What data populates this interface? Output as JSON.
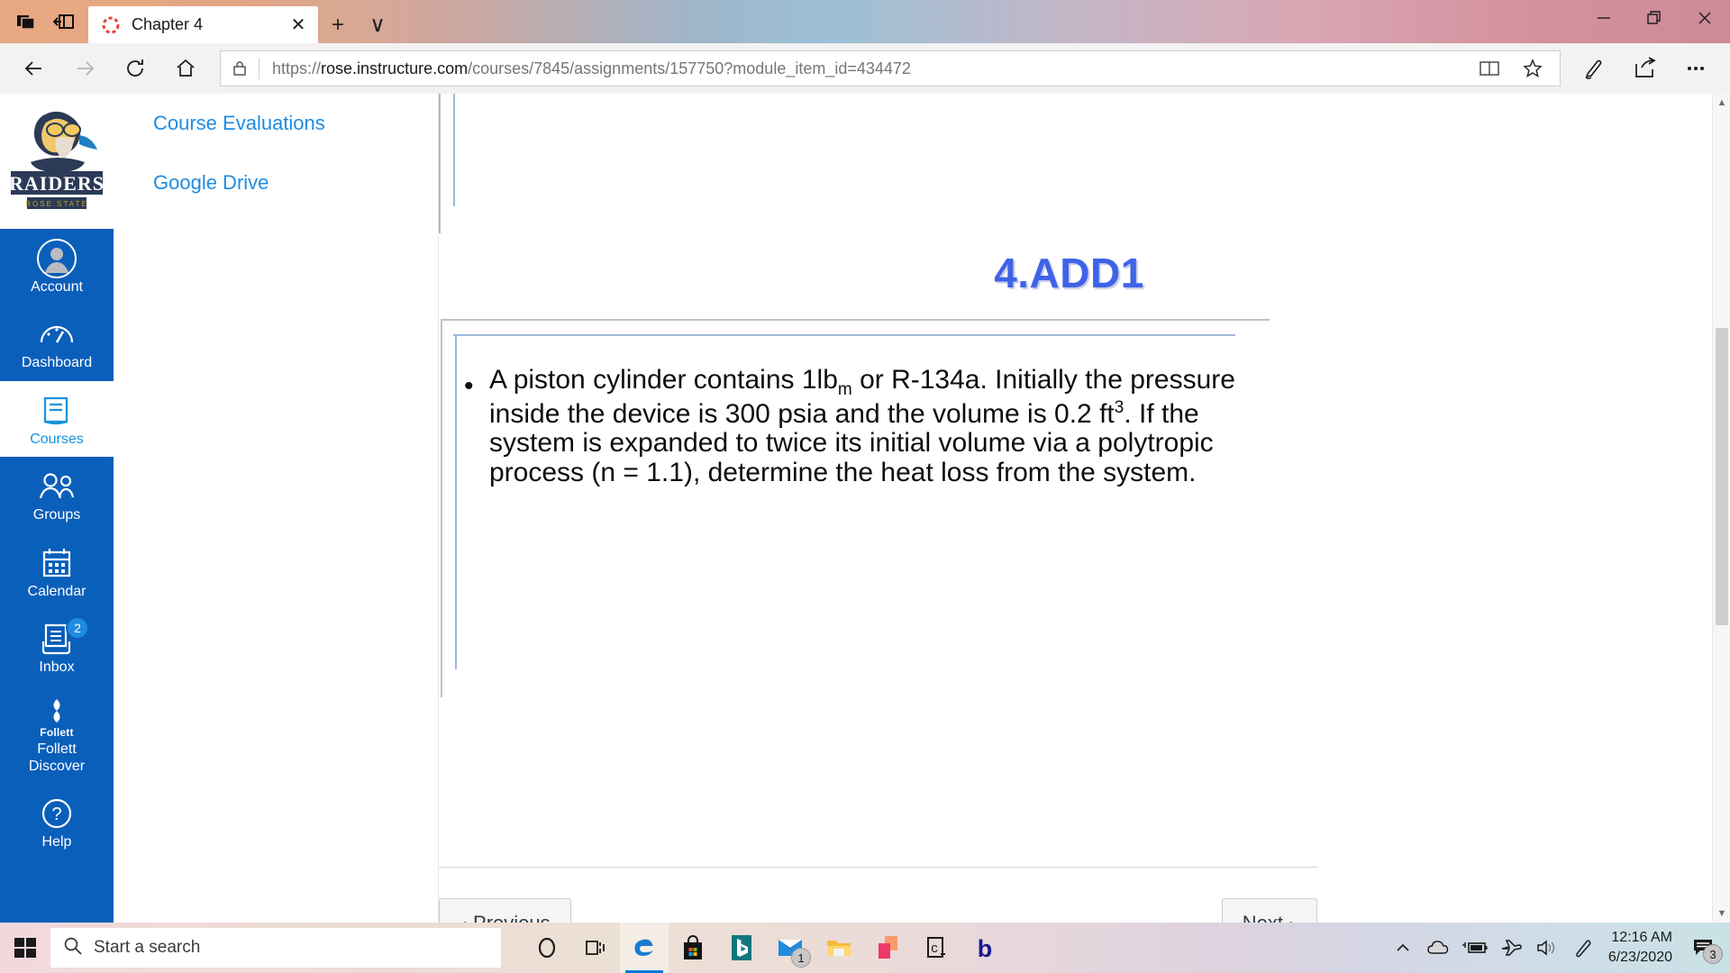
{
  "browser": {
    "tab": {
      "title": "Chapter 4",
      "favicon": "loading-spinner-icon",
      "close_label": "✕"
    },
    "new_tab_label": "+",
    "tab_menu_label": "∨",
    "window_controls": {
      "minimize": "—",
      "restore": "❐",
      "close": "✕"
    },
    "nav": {
      "back": "←",
      "forward": "→",
      "refresh": "↻",
      "home": "⌂"
    },
    "address": {
      "scheme": "https://",
      "host": "rose.instructure.com",
      "path": "/courses/7845/assignments/157750?module_item_id=434472",
      "full_url": "https://rose.instructure.com/courses/7845/assignments/157750?module_item_id=434472",
      "lock_icon": "lock-icon",
      "reading_view_icon": "book-icon",
      "favorite_icon": "star-icon"
    },
    "toolbar": {
      "notes_icon": "pen-icon",
      "share_icon": "share-icon",
      "more_icon": "ellipsis-icon"
    }
  },
  "sidebar": {
    "logo_alt": "RAIDERS ROSE STATE",
    "items": [
      {
        "label": "Account",
        "icon": "user-avatar-icon",
        "active": false,
        "badge": null
      },
      {
        "label": "Dashboard",
        "icon": "dashboard-gauge-icon",
        "active": false,
        "badge": null
      },
      {
        "label": "Courses",
        "icon": "book-icon",
        "active": true,
        "badge": null
      },
      {
        "label": "Groups",
        "icon": "people-icon",
        "active": false,
        "badge": null
      },
      {
        "label": "Calendar",
        "icon": "calendar-icon",
        "active": false,
        "badge": null
      },
      {
        "label": "Inbox",
        "icon": "inbox-tray-icon",
        "active": false,
        "badge": "2"
      },
      {
        "label": "Follett\nDiscover",
        "icon": "follett-diamond-icon",
        "brand": "Follett",
        "active": false,
        "badge": null
      },
      {
        "label": "Help",
        "icon": "question-circle-icon",
        "active": false,
        "badge": null
      }
    ]
  },
  "course_nav": {
    "links": [
      {
        "label": "Course Evaluations"
      },
      {
        "label": "Google Drive"
      }
    ]
  },
  "slide": {
    "title": "4.ADD1",
    "bullet_marker": "•",
    "body_parts": [
      {
        "t": "A piston cylinder contains 1lb"
      },
      {
        "t": "m",
        "s": "sub"
      },
      {
        "t": " or R-134a. Initially the pressure inside the device is 300 psia and the volume is 0.2 ft"
      },
      {
        "t": "3",
        "s": "sup"
      },
      {
        "t": ". If the system is expanded to twice its initial volume via a polytropic process (n = 1.1), determine the heat loss from the system."
      }
    ],
    "body_text": "A piston cylinder contains 1lbm or R-134a. Initially the pressure inside the device is 300 psia and the volume is 0.2 ft3. If the system is expanded to twice its initial volume via a polytropic process (n = 1.1), determine the heat loss from the system."
  },
  "pager": {
    "previous_label": "Previous",
    "next_label": "Next",
    "prev_caret": "◂",
    "next_caret": "▸"
  },
  "scrollbar": {
    "up": "▲",
    "down": "▼"
  },
  "taskbar": {
    "start_label": "start-button",
    "search_placeholder": "Start a search",
    "search_icon": "magnifier-icon",
    "items": [
      {
        "name": "cortana-icon",
        "label": "Cortana",
        "active": false,
        "badge": null
      },
      {
        "name": "task-view-icon",
        "label": "Task View",
        "active": false,
        "badge": null
      },
      {
        "name": "edge-icon",
        "label": "Microsoft Edge",
        "active": true,
        "badge": null
      },
      {
        "name": "microsoft-store-icon",
        "label": "Microsoft Store",
        "active": false,
        "badge": null
      },
      {
        "name": "bing-icon",
        "label": "Bing",
        "active": false,
        "badge": null
      },
      {
        "name": "mail-icon",
        "label": "Mail",
        "active": false,
        "badge": "1"
      },
      {
        "name": "file-explorer-icon",
        "label": "File Explorer",
        "active": false,
        "badge": null
      },
      {
        "name": "photos-icon",
        "label": "Photos",
        "active": false,
        "badge": null
      },
      {
        "name": "terminal-icon",
        "label": "C_",
        "active": false,
        "badge": null
      },
      {
        "name": "b-app-icon",
        "label": "b",
        "active": false,
        "badge": null
      }
    ],
    "tray": [
      {
        "name": "show-hidden-icons-chevron-icon",
        "glyph": "∧"
      },
      {
        "name": "onedrive-icon",
        "glyph": ""
      },
      {
        "name": "battery-charging-icon",
        "glyph": ""
      },
      {
        "name": "airplane-mode-icon",
        "glyph": ""
      },
      {
        "name": "volume-icon",
        "glyph": ""
      },
      {
        "name": "pen-workspace-icon",
        "glyph": ""
      }
    ],
    "clock": {
      "time": "12:16 AM",
      "date": "6/23/2020"
    },
    "action_center": {
      "icon": "action-center-icon",
      "badge": "3"
    }
  },
  "colors": {
    "canvas_blue": "#0a5fba",
    "link_blue": "#1e8ce2",
    "title_blue": "#3f63e8",
    "taskbar_accent": "#0078d7"
  }
}
